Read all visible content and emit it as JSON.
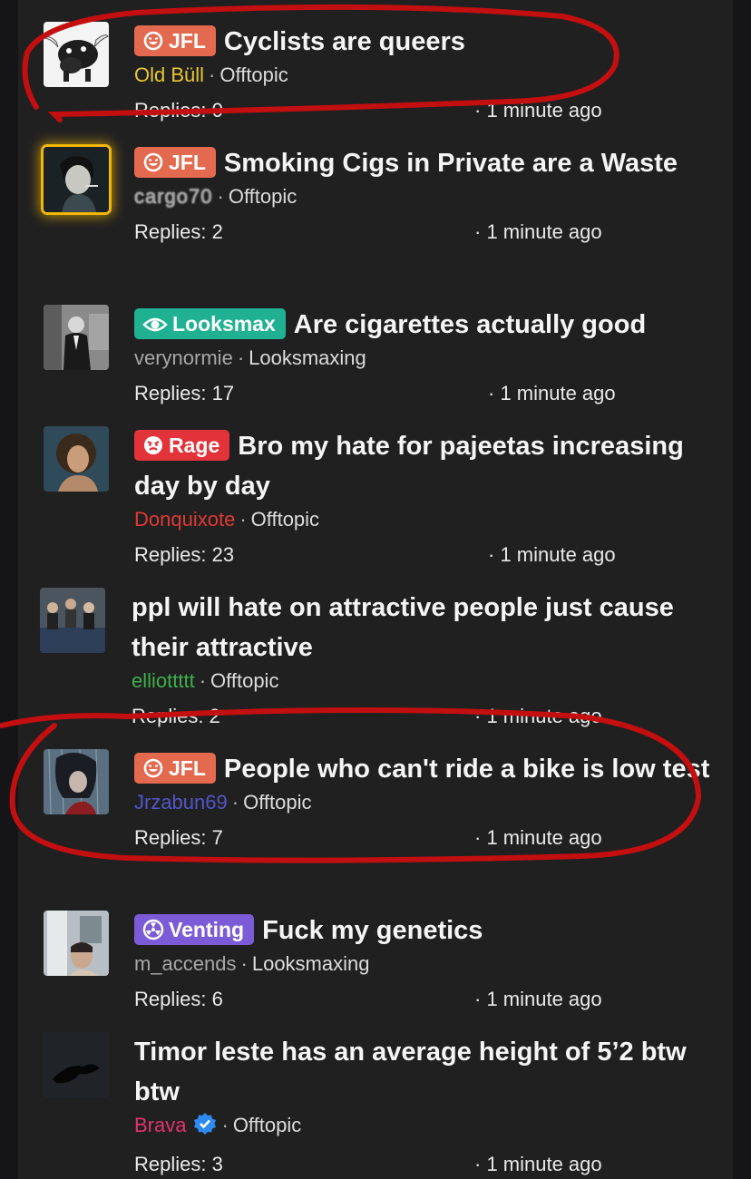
{
  "colors": {
    "background": "#202021",
    "jfl_tag": "#e36a4f",
    "looksmax_tag": "#1fb191",
    "rage_tag": "#e3333a",
    "venting_tag": "#7b5cd6",
    "annotation": "#c30f0f"
  },
  "threads": [
    {
      "tag": "JFL",
      "tag_icon": "laugh-icon",
      "title": "Cyclists are queers",
      "author": "Old Büll",
      "author_color": "#e8c72e",
      "category": "Offtopic",
      "replies": "Replies: 0",
      "time": "· 1 minute ago"
    },
    {
      "tag": "JFL",
      "tag_icon": "laugh-icon",
      "title": "Smoking Cigs in Private are a Waste",
      "author": "cargo70",
      "author_color": "#9a9a9a",
      "category": "Offtopic",
      "replies": "Replies: 2",
      "time": "· 1 minute ago"
    },
    {
      "tag": "Looksmax",
      "tag_icon": "eye-icon",
      "title": "Are cigarettes actually good",
      "author": "verynormie",
      "author_color": "#a8a8a8",
      "category": "Looksmaxing",
      "replies": "Replies: 17",
      "time": "· 1 minute ago"
    },
    {
      "tag": "Rage",
      "tag_icon": "angry-face-icon",
      "title": "Bro my hate for pajeetas increasing day by day",
      "author": "Donquixote",
      "author_color": "#e03a33",
      "category": "Offtopic",
      "replies": "Replies: 23",
      "time": "· 1 minute ago"
    },
    {
      "tag": "",
      "tag_icon": "",
      "title": "ppl will hate on attractive people just cause their attractive",
      "author": "elliottttt",
      "author_color": "#3fae49",
      "category": "Offtopic",
      "replies": "Replies: 2",
      "time": "· 1 minute ago"
    },
    {
      "tag": "JFL",
      "tag_icon": "laugh-icon",
      "title": "People who can't ride a bike is low test",
      "author": "Jrzabun69",
      "author_color": "#5356c9",
      "category": "Offtopic",
      "replies": "Replies: 7",
      "time": "· 1 minute ago"
    },
    {
      "tag": "Venting",
      "tag_icon": "radiation-icon",
      "title": "Fuck my genetics",
      "author": "m_accends",
      "author_color": "#a8a8a8",
      "category": "Looksmaxing",
      "replies": "Replies: 6",
      "time": "· 1 minute ago"
    },
    {
      "tag": "",
      "tag_icon": "",
      "title": "Timor leste has an average height of 5’2 btw btw",
      "author": "Brava",
      "author_color": "#e0336d",
      "author_badge": "verified-check-icon",
      "category": "Offtopic",
      "replies": "Replies: 3",
      "time": "· 1 minute ago"
    }
  ]
}
